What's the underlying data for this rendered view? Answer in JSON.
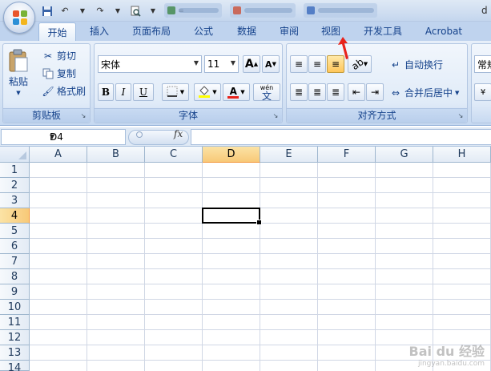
{
  "titlebar": {
    "trailing_text": "d"
  },
  "tabs": [
    {
      "label": "开始",
      "active": true
    },
    {
      "label": "插入"
    },
    {
      "label": "页面布局"
    },
    {
      "label": "公式"
    },
    {
      "label": "数据"
    },
    {
      "label": "审阅"
    },
    {
      "label": "视图"
    },
    {
      "label": "开发工具"
    },
    {
      "label": "Acrobat"
    }
  ],
  "ribbon": {
    "clipboard": {
      "label": "剪贴板",
      "paste": "粘贴",
      "cut": "剪切",
      "copy": "复制",
      "format_painter": "格式刷"
    },
    "font": {
      "label": "字体",
      "font_name": "宋体",
      "font_size": "11",
      "grow": "A",
      "shrink": "A",
      "bold": "B",
      "italic": "I",
      "underline": "U",
      "font_color_glyph": "A",
      "phonetic": "wén"
    },
    "alignment": {
      "label": "对齐方式",
      "wrap_text": "自动换行",
      "merge_center": "合并后居中"
    },
    "number": {
      "format_partial": "常规"
    }
  },
  "formula_bar": {
    "name_box": "D4",
    "fx": "fx",
    "formula": ""
  },
  "sheet": {
    "columns": [
      "A",
      "B",
      "C",
      "D",
      "E",
      "F",
      "G",
      "H"
    ],
    "rows": [
      "1",
      "2",
      "3",
      "4",
      "5",
      "6",
      "7",
      "8",
      "9",
      "10",
      "11",
      "12",
      "13",
      "14"
    ],
    "active_cell": "D4"
  },
  "watermark": {
    "brand": "Bai du 经验",
    "url": "jingyan.baidu.com"
  },
  "colors": {
    "accent_tab_text": "#15428b",
    "selected_header": "#f8c978",
    "annotation_arrow": "#e8231b"
  }
}
